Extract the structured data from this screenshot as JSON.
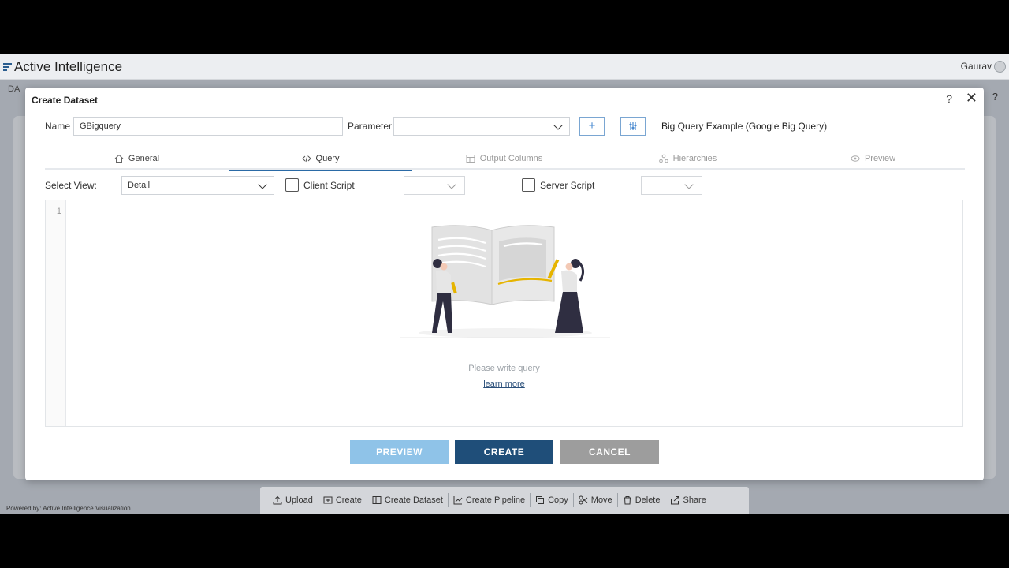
{
  "app": {
    "title": "Active Intelligence",
    "user": "Gaurav",
    "bg_label": "DA",
    "bg_help": "?"
  },
  "dialog": {
    "title": "Create Dataset",
    "help": "?",
    "close": "✕",
    "name_label": "Name",
    "name_value": "GBigquery",
    "parameter_label": "Parameter",
    "parameter_value": "",
    "add_button": "+",
    "settings_button": "⫶",
    "datasource_label": "Big Query Example (Google Big Query)"
  },
  "tabs": [
    {
      "label": "General",
      "icon": "home-icon"
    },
    {
      "label": "Query",
      "icon": "code-icon",
      "active": true
    },
    {
      "label": "Output Columns",
      "icon": "table-icon"
    },
    {
      "label": "Hierarchies",
      "icon": "hierarchy-icon"
    },
    {
      "label": "Preview",
      "icon": "eye-icon"
    }
  ],
  "query": {
    "select_view_label": "Select View:",
    "select_view_value": "Detail",
    "client_script_label": "Client Script",
    "server_script_label": "Server Script",
    "line_number": "1",
    "hint": "Please write query",
    "learn_more": "learn more"
  },
  "buttons": {
    "preview": "PREVIEW",
    "create": "CREATE",
    "cancel": "CANCEL"
  },
  "toolbar": {
    "upload": "Upload",
    "create": "Create",
    "create_dataset": "Create Dataset",
    "create_pipeline": "Create Pipeline",
    "copy": "Copy",
    "move": "Move",
    "delete": "Delete",
    "share": "Share"
  },
  "footer": "Powered by: Active Intelligence Visualization",
  "colors": {
    "primary": "#1f4e79",
    "preview_btn": "#8fc3e8",
    "cancel_btn": "#9d9d9d",
    "accent_line": "#e6b400"
  }
}
